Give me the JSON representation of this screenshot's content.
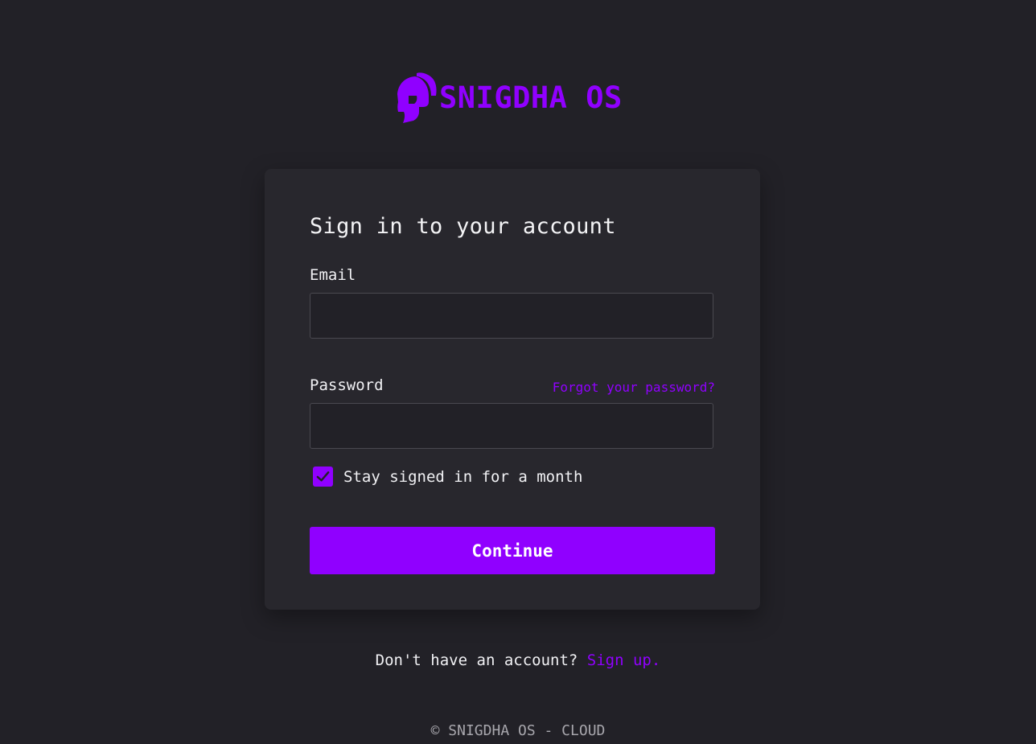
{
  "brand": {
    "name": "SNIGDHA OS",
    "logo_icon": "spartan-helmet-icon",
    "accent_color": "#9000ff"
  },
  "login_card": {
    "title": "Sign in to your account",
    "email": {
      "label": "Email",
      "value": "",
      "placeholder": ""
    },
    "password": {
      "label": "Password",
      "value": "",
      "placeholder": "",
      "forgot_link": "Forgot your password?"
    },
    "remember_me": {
      "label": "Stay signed in for a month",
      "checked": true,
      "icon": "checkmark-icon"
    },
    "submit_label": "Continue"
  },
  "signup": {
    "prompt": "Don't have an account?",
    "link": "Sign up."
  },
  "footer": {
    "text": "© SNIGDHA OS - CLOUD"
  },
  "colors": {
    "background": "#222127",
    "card": "#28272d",
    "input_border": "#4a4950",
    "text": "#f1f1f4",
    "muted_text": "#a8a7ad"
  }
}
